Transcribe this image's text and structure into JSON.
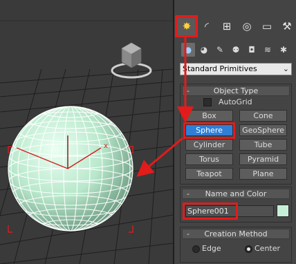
{
  "command_panel": {
    "tabs": [
      {
        "name": "create",
        "icon": "sun-icon",
        "active": true
      },
      {
        "name": "modify",
        "icon": "modify-curve-icon"
      },
      {
        "name": "hierarchy",
        "icon": "hierarchy-icon"
      },
      {
        "name": "motion",
        "icon": "motion-icon"
      },
      {
        "name": "display",
        "icon": "display-monitor-icon"
      },
      {
        "name": "utilities",
        "icon": "hammer-icon"
      }
    ],
    "create_categories": [
      {
        "name": "geometry",
        "icon": "sphere-icon",
        "active": true
      },
      {
        "name": "shapes",
        "icon": "shapes-icon"
      },
      {
        "name": "lights",
        "icon": "light-icon"
      },
      {
        "name": "cameras",
        "icon": "camera-icon"
      },
      {
        "name": "helpers",
        "icon": "helper-icon"
      },
      {
        "name": "space_warps",
        "icon": "wave-icon"
      },
      {
        "name": "systems",
        "icon": "gears-icon"
      }
    ],
    "dropdown": {
      "value": "Standard Primitives"
    }
  },
  "object_type": {
    "title": "Object Type",
    "collapse": "-",
    "autogrid_label": "AutoGrid",
    "buttons": {
      "box": "Box",
      "cone": "Cone",
      "sphere": "Sphere",
      "geosphere": "GeoSphere",
      "cylinder": "Cylinder",
      "tube": "Tube",
      "torus": "Torus",
      "pyramid": "Pyramid",
      "teapot": "Teapot",
      "plane": "Plane"
    },
    "active_button": "sphere"
  },
  "name_and_color": {
    "title": "Name and Color",
    "collapse": "-",
    "name_value": "Sphere001",
    "color": "#c7efd8"
  },
  "creation_method": {
    "title": "Creation Method",
    "collapse": "-",
    "options": {
      "edge": "Edge",
      "center": "Center"
    },
    "selected": "center"
  },
  "viewport": {
    "axis_x_label": "x",
    "viewcube_icon": "viewcube-icon",
    "sphere_color": "#c8f0d8",
    "wire_color": "#ffffff",
    "selection_bracket_color": "#d21e1e"
  },
  "annotations": {
    "highlight_color": "#e31b1b"
  }
}
